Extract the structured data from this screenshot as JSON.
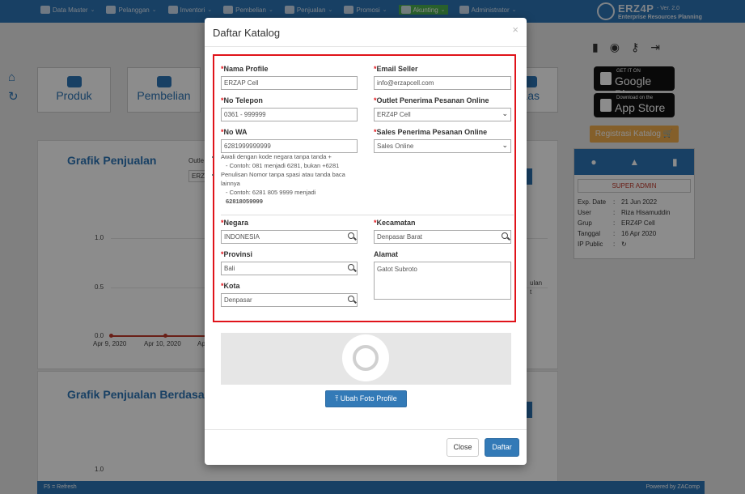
{
  "nav": {
    "items": [
      {
        "label": "Data Master"
      },
      {
        "label": "Pelanggan"
      },
      {
        "label": "Inventori"
      },
      {
        "label": "Pembelian"
      },
      {
        "label": "Penjualan"
      },
      {
        "label": "Promosi"
      },
      {
        "label": "Akunting"
      },
      {
        "label": "Administrator"
      }
    ],
    "active_item": "Akunting"
  },
  "brand": {
    "name": "ERZ4P",
    "version": "- Ver. 2.0",
    "subtitle": "Enterprise Resources Planning"
  },
  "tiles": {
    "produk": "Produk",
    "pembelian": "Pembelian",
    "kas": "Kas"
  },
  "background": {
    "chart1_title": "Grafik Penjualan",
    "chart1_filter_label": "Outle",
    "chart1_filter_value": "ERZ",
    "chart2_title": "Grafik Penjualan Berdasa",
    "side_text_1": "ulan",
    "side_text_2": "t"
  },
  "chart_data": {
    "type": "line",
    "title": "Grafik Penjualan",
    "x": [
      "Apr 9, 2020",
      "Apr 10, 2020",
      "Apr"
    ],
    "series": [
      {
        "values": [
          0.0,
          0.0,
          0.0
        ]
      }
    ],
    "yticks": [
      "1.0",
      "0.5",
      "0.0"
    ],
    "ylim": [
      0,
      1.0
    ],
    "chart2_ytick": "1.0"
  },
  "sidebar_right": {
    "google_play_small": "GET IT ON",
    "google_play_big": "Google Play",
    "app_store_small": "Download on the",
    "app_store_big": "App Store",
    "register_label": "Registrasi Katalog",
    "role": "SUPER ADMIN",
    "rows": [
      {
        "key": "Exp. Date",
        "value": "21 Jun 2022"
      },
      {
        "key": "User",
        "value": "Riza Hisamuddin"
      },
      {
        "key": "Grup",
        "value": "ERZ4P Cell"
      },
      {
        "key": "Tanggal",
        "value": "16 Apr 2020"
      },
      {
        "key": "IP Public",
        "value": ""
      }
    ]
  },
  "footer": {
    "left": "F5 = Refresh",
    "right": "Powered by ZAComp"
  },
  "modal": {
    "title": "Daftar Katalog",
    "close_symbol": "×",
    "required_mark": "*",
    "fields": {
      "nama_profile": {
        "label": "Nama Profile",
        "value": "ERZAP Cell"
      },
      "email_seller": {
        "label": "Email Seller",
        "value": "info@erzapcell.com"
      },
      "no_telepon": {
        "label": "No Telepon",
        "value": "0361 - 999999"
      },
      "outlet": {
        "label": "Outlet Penerima Pesanan Online",
        "value": "ERZ4P Cell"
      },
      "no_wa": {
        "label": "No WA",
        "value": "6281999999999"
      },
      "sales": {
        "label": "Sales Penerima Pesanan Online",
        "value": "Sales Online"
      },
      "negara": {
        "label": "Negara",
        "value": "INDONESIA"
      },
      "kecamatan": {
        "label": "Kecamatan",
        "value": "Denpasar Barat"
      },
      "provinsi": {
        "label": "Provinsi",
        "value": "Bali"
      },
      "alamat": {
        "label": "Alamat",
        "value": "Gatot Subroto"
      },
      "kota": {
        "label": "Kota",
        "value": "Denpasar"
      }
    },
    "hint": {
      "line1": "Awali dengan kode negara tanpa tanda +",
      "line1_example": "- Contoh: 081 menjadi 6281, bukan +6281",
      "line2": "Penulisan Nomor tanpa spasi atau tanda baca lainnya",
      "line2_example": "- Contoh: 6281 805 9999 menjadi",
      "line2_result": "62818059999"
    },
    "upload_label": "Ubah Foto Profile",
    "close_label": "Close",
    "submit_label": "Daftar"
  }
}
